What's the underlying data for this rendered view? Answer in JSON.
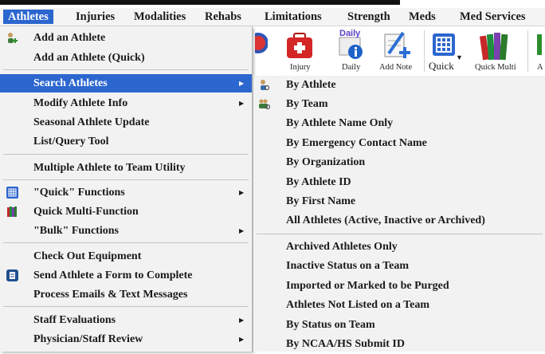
{
  "menubar": {
    "items": [
      {
        "label": "Athletes",
        "active": true
      },
      {
        "label": "Injuries"
      },
      {
        "label": "Modalities"
      },
      {
        "label": "Rehabs"
      },
      {
        "label": "Limitations"
      },
      {
        "label": "Strength"
      },
      {
        "label": "Meds"
      },
      {
        "label": "Med Services"
      }
    ]
  },
  "toolbar": {
    "buttons": [
      {
        "label": "Injury",
        "icon": "first-aid-kit-icon"
      },
      {
        "label": "Daily",
        "icon": "daily-info-icon",
        "badge": "Daily"
      },
      {
        "label": "Add Note",
        "icon": "add-note-icon"
      },
      {
        "label": "Quick",
        "icon": "grid-icon"
      },
      {
        "label": "Quick Multi",
        "icon": "books-icon"
      },
      {
        "label": "A",
        "icon": "add-icon"
      }
    ]
  },
  "athletes_menu": {
    "items": [
      {
        "label": "Add an Athlete",
        "icon": "add-athlete-icon"
      },
      {
        "label": "Add an Athlete (Quick)"
      },
      {
        "label": "Search Athletes",
        "has_submenu": true,
        "highlighted": true
      },
      {
        "label": "Modify Athlete Info",
        "has_submenu": true
      },
      {
        "label": "Seasonal Athlete Update"
      },
      {
        "label": "List/Query Tool"
      },
      {
        "label": "Multiple Athlete to Team Utility"
      },
      {
        "label": "\"Quick\" Functions",
        "icon": "grid-icon",
        "has_submenu": true
      },
      {
        "label": "Quick Multi-Function",
        "icon": "books-icon"
      },
      {
        "label": "\"Bulk\" Functions",
        "has_submenu": true
      },
      {
        "label": "Check Out Equipment"
      },
      {
        "label": "Send Athlete a Form to Complete",
        "icon": "form-icon"
      },
      {
        "label": "Process Emails & Text Messages"
      },
      {
        "label": "Staff Evaluations",
        "has_submenu": true
      },
      {
        "label": "Physician/Staff Review",
        "has_submenu": true
      }
    ]
  },
  "search_submenu": {
    "items": [
      {
        "label": "By Athlete",
        "icon": "athlete-search-icon"
      },
      {
        "label": "By Team",
        "icon": "team-search-icon"
      },
      {
        "label": "By Athlete Name Only"
      },
      {
        "label": "By Emergency Contact Name"
      },
      {
        "label": "By Organization"
      },
      {
        "label": "By Athlete ID"
      },
      {
        "label": "By First Name"
      },
      {
        "label": "All Athletes (Active, Inactive or Archived)"
      },
      {
        "label": "Archived Athletes Only"
      },
      {
        "label": "Inactive Status on a Team"
      },
      {
        "label": "Imported or Marked to be Purged"
      },
      {
        "label": "Athletes Not Listed on a Team"
      },
      {
        "label": "By Status on Team"
      },
      {
        "label": "By NCAA/HS Submit ID"
      }
    ]
  },
  "colors": {
    "highlight": "#2c66cf",
    "menu_bg": "#f2f2f2",
    "menubar_bg": "#f4f4f4"
  }
}
